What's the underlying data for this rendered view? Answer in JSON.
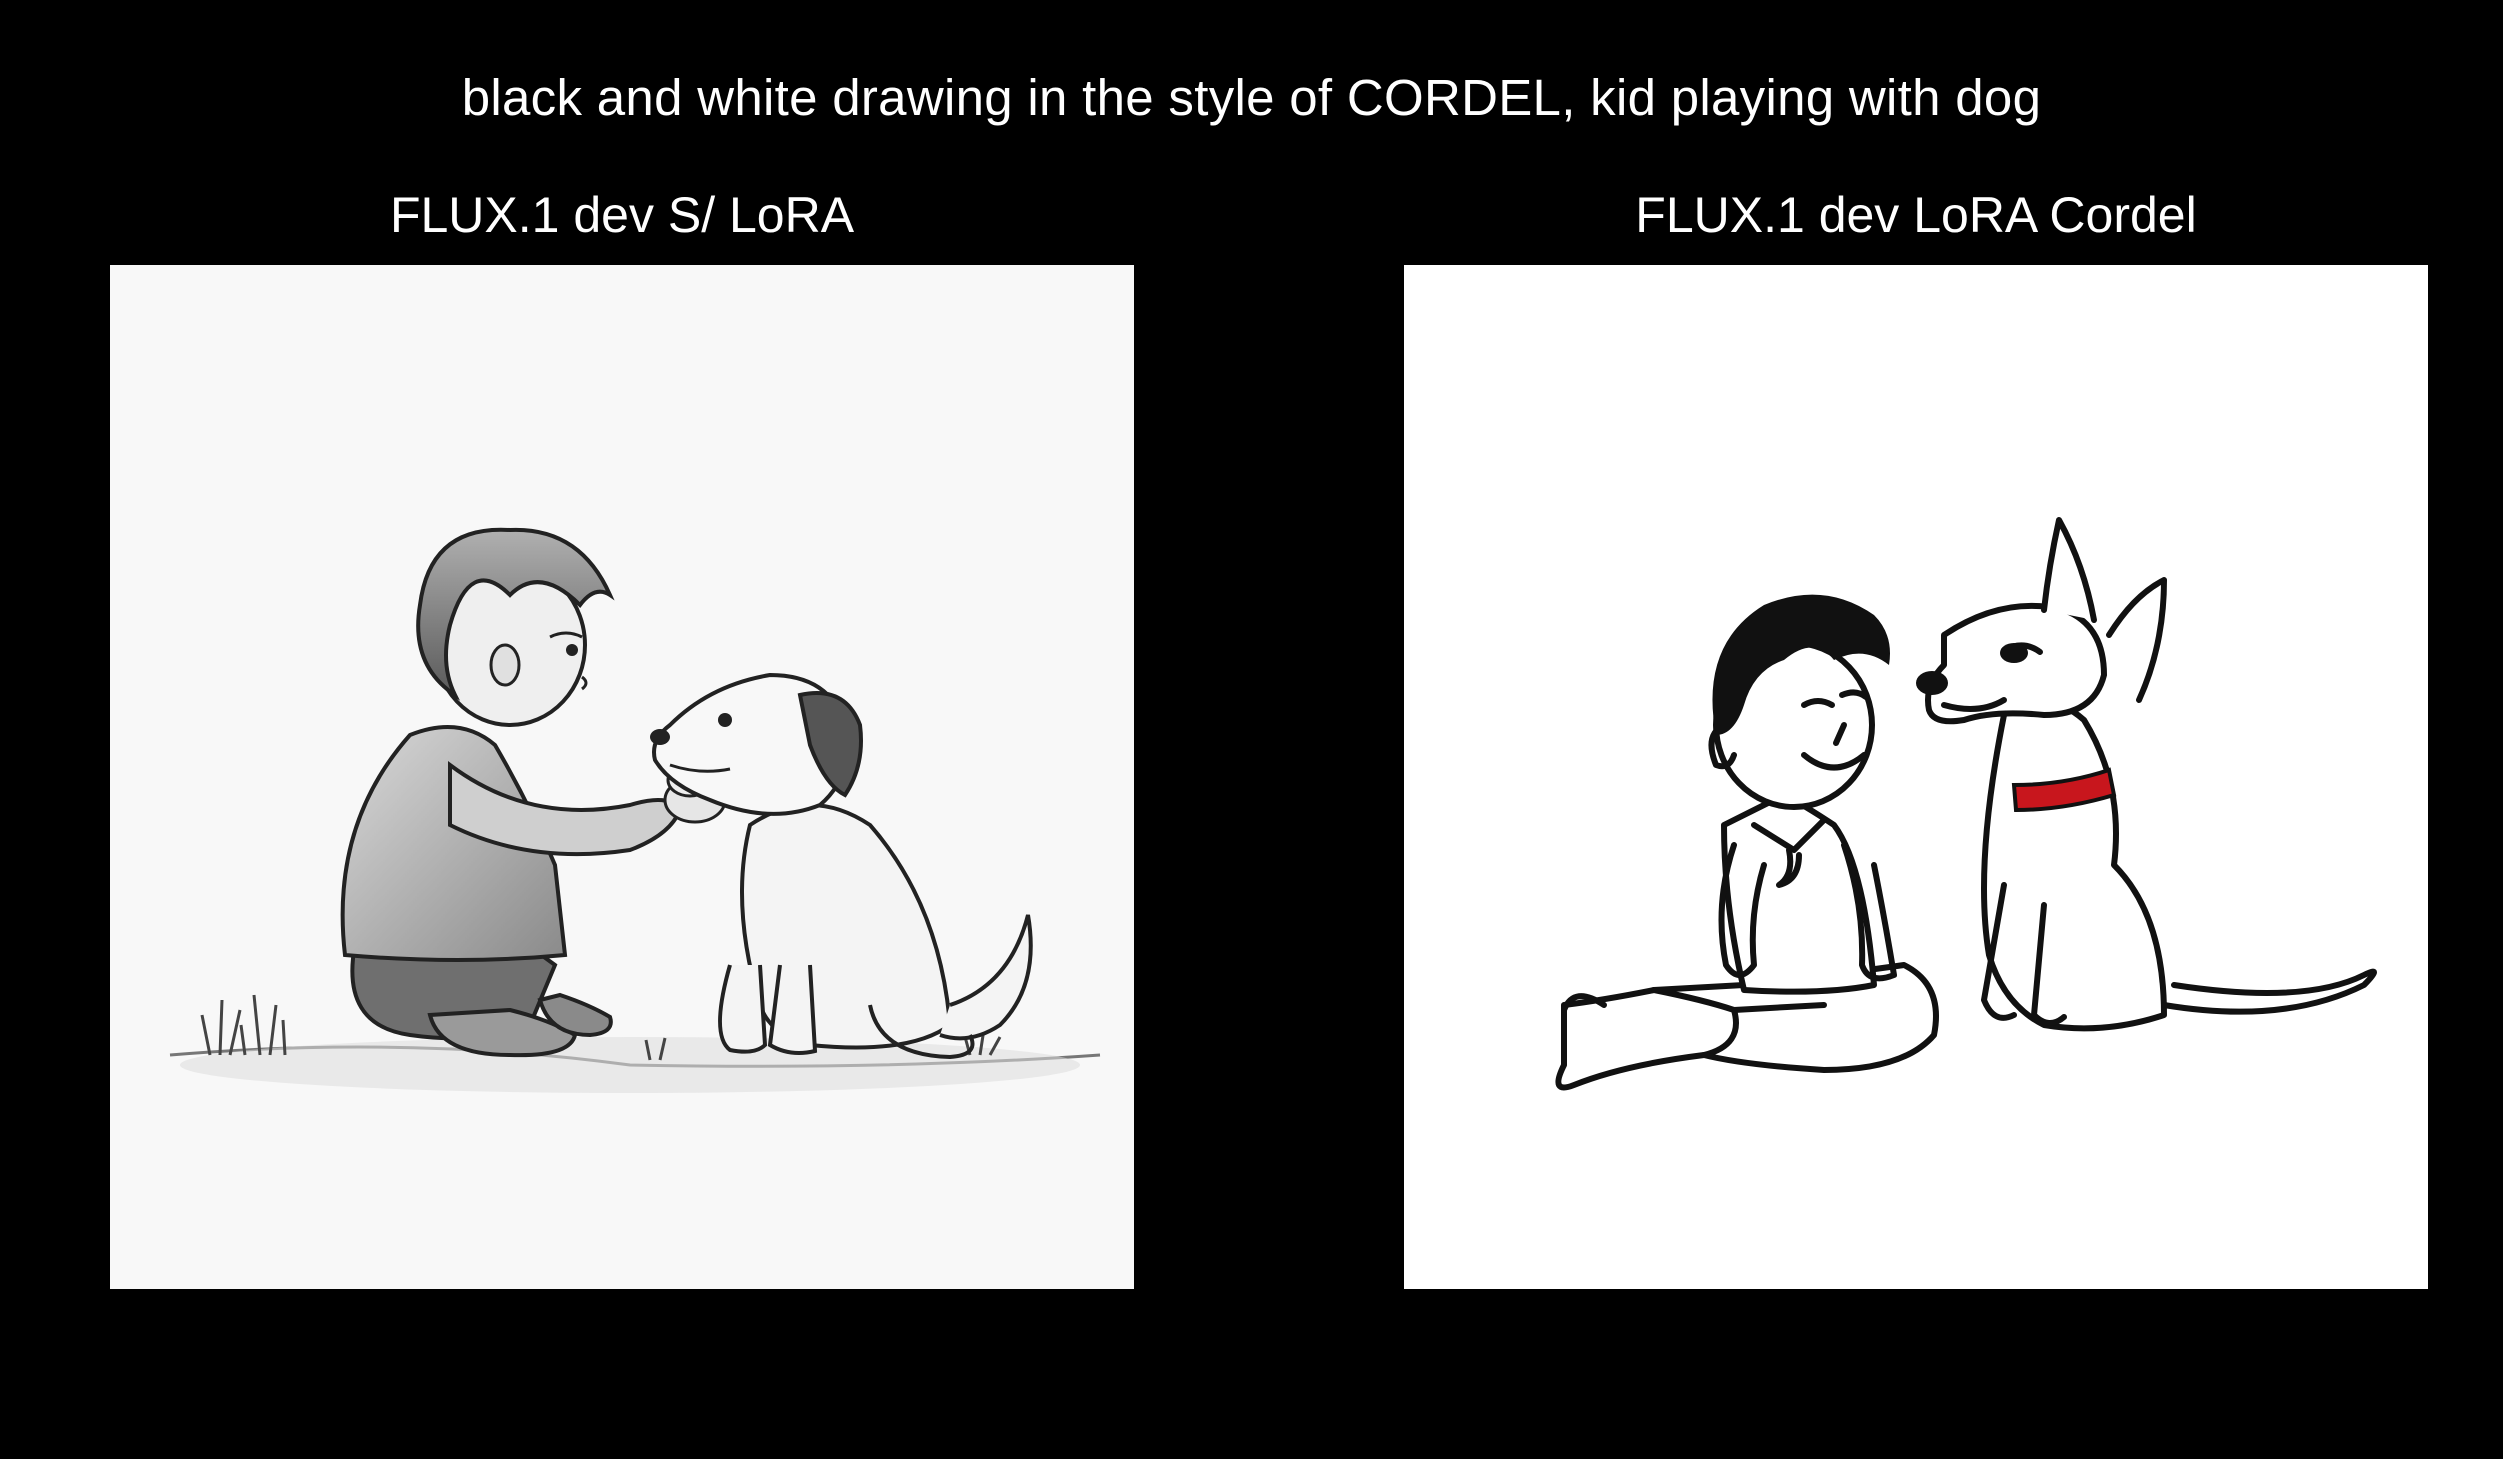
{
  "prompt": "black and white drawing in the style of CORDEL, kid playing with dog",
  "panels": [
    {
      "label": "FLUX.1 dev S/ LoRA"
    },
    {
      "label": "FLUX.1 dev LoRA Cordel",
      "accent_color": "#c8161d"
    }
  ],
  "colors": {
    "background": "#000000",
    "text": "#ffffff"
  }
}
